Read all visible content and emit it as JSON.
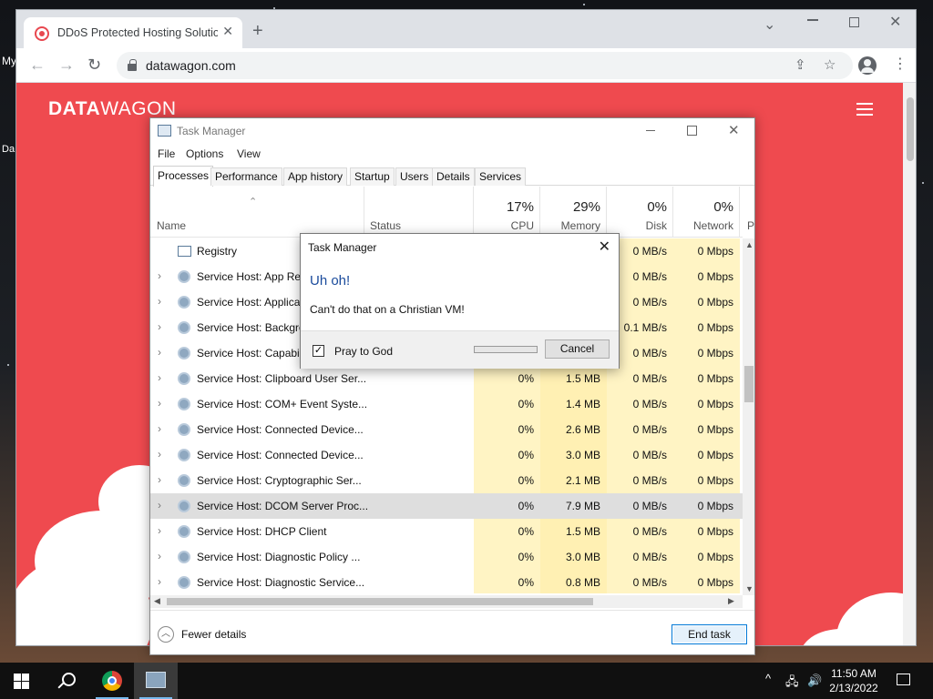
{
  "desktop": {
    "labels": [
      "My",
      "Da"
    ]
  },
  "browser": {
    "tab_title": "DDoS Protected Hosting Solution",
    "url": "datawagon.com"
  },
  "site": {
    "logo_bold": "DATA",
    "logo_rest": "WAGON",
    "bg_color": "#ef4a4f"
  },
  "taskmgr": {
    "title": "Task Manager",
    "menu": [
      "File",
      "Options",
      "View"
    ],
    "tabs": [
      "Processes",
      "Performance",
      "App history",
      "Startup",
      "Users",
      "Details",
      "Services"
    ],
    "active_tab": "Processes",
    "columns": {
      "name": "Name",
      "status": "Status",
      "cpu": {
        "pct": "17%",
        "label": "CPU"
      },
      "memory": {
        "pct": "29%",
        "label": "Memory"
      },
      "disk": {
        "pct": "0%",
        "label": "Disk"
      },
      "network": {
        "pct": "0%",
        "label": "Network"
      },
      "next": "P"
    },
    "rows": [
      {
        "name": "Registry",
        "cpu": "",
        "mem": "",
        "disk": "0 MB/s",
        "net": "0 Mbps",
        "expand": false,
        "icon": "registry-icon"
      },
      {
        "name": "Service Host: App Rea",
        "cpu": "",
        "mem": "",
        "disk": "0 MB/s",
        "net": "0 Mbps",
        "expand": true,
        "icon": "gear-icon"
      },
      {
        "name": "Service Host: Applicat",
        "cpu": "",
        "mem": "",
        "disk": "0 MB/s",
        "net": "0 Mbps",
        "expand": true,
        "icon": "gear-icon"
      },
      {
        "name": "Service Host: Backgro",
        "cpu": "",
        "mem": "",
        "disk": "0.1 MB/s",
        "net": "0 Mbps",
        "expand": true,
        "icon": "gear-icon"
      },
      {
        "name": "Service Host: Capabili",
        "cpu": "",
        "mem": "",
        "disk": "0 MB/s",
        "net": "0 Mbps",
        "expand": true,
        "icon": "gear-icon"
      },
      {
        "name": "Service Host: Clipboard User Ser...",
        "cpu": "0%",
        "mem": "1.5 MB",
        "disk": "0 MB/s",
        "net": "0 Mbps",
        "expand": true,
        "icon": "gear-icon"
      },
      {
        "name": "Service Host: COM+ Event Syste...",
        "cpu": "0%",
        "mem": "1.4 MB",
        "disk": "0 MB/s",
        "net": "0 Mbps",
        "expand": true,
        "icon": "gear-icon"
      },
      {
        "name": "Service Host: Connected Device...",
        "cpu": "0%",
        "mem": "2.6 MB",
        "disk": "0 MB/s",
        "net": "0 Mbps",
        "expand": true,
        "icon": "gear-icon"
      },
      {
        "name": "Service Host: Connected Device...",
        "cpu": "0%",
        "mem": "3.0 MB",
        "disk": "0 MB/s",
        "net": "0 Mbps",
        "expand": true,
        "icon": "gear-icon"
      },
      {
        "name": "Service Host: Cryptographic Ser...",
        "cpu": "0%",
        "mem": "2.1 MB",
        "disk": "0 MB/s",
        "net": "0 Mbps",
        "expand": true,
        "icon": "gear-icon"
      },
      {
        "name": "Service Host: DCOM Server Proc...",
        "cpu": "0%",
        "mem": "7.9 MB",
        "disk": "0 MB/s",
        "net": "0 Mbps",
        "expand": true,
        "icon": "gear-icon",
        "selected": true
      },
      {
        "name": "Service Host: DHCP Client",
        "cpu": "0%",
        "mem": "1.5 MB",
        "disk": "0 MB/s",
        "net": "0 Mbps",
        "expand": true,
        "icon": "gear-icon"
      },
      {
        "name": "Service Host: Diagnostic Policy ...",
        "cpu": "0%",
        "mem": "3.0 MB",
        "disk": "0 MB/s",
        "net": "0 Mbps",
        "expand": true,
        "icon": "gear-icon"
      },
      {
        "name": "Service Host: Diagnostic Service...",
        "cpu": "0%",
        "mem": "0.8 MB",
        "disk": "0 MB/s",
        "net": "0 Mbps",
        "expand": true,
        "icon": "gear-icon"
      }
    ],
    "fewer_details": "Fewer details",
    "end_task": "End task"
  },
  "dialog": {
    "title": "Task Manager",
    "heading": "Uh oh!",
    "message": "Can't do that on a Christian VM!",
    "checkbox_label": "Pray to God",
    "checked": true,
    "cancel": "Cancel"
  },
  "taskbar": {
    "time": "11:50 AM",
    "date": "2/13/2022"
  }
}
